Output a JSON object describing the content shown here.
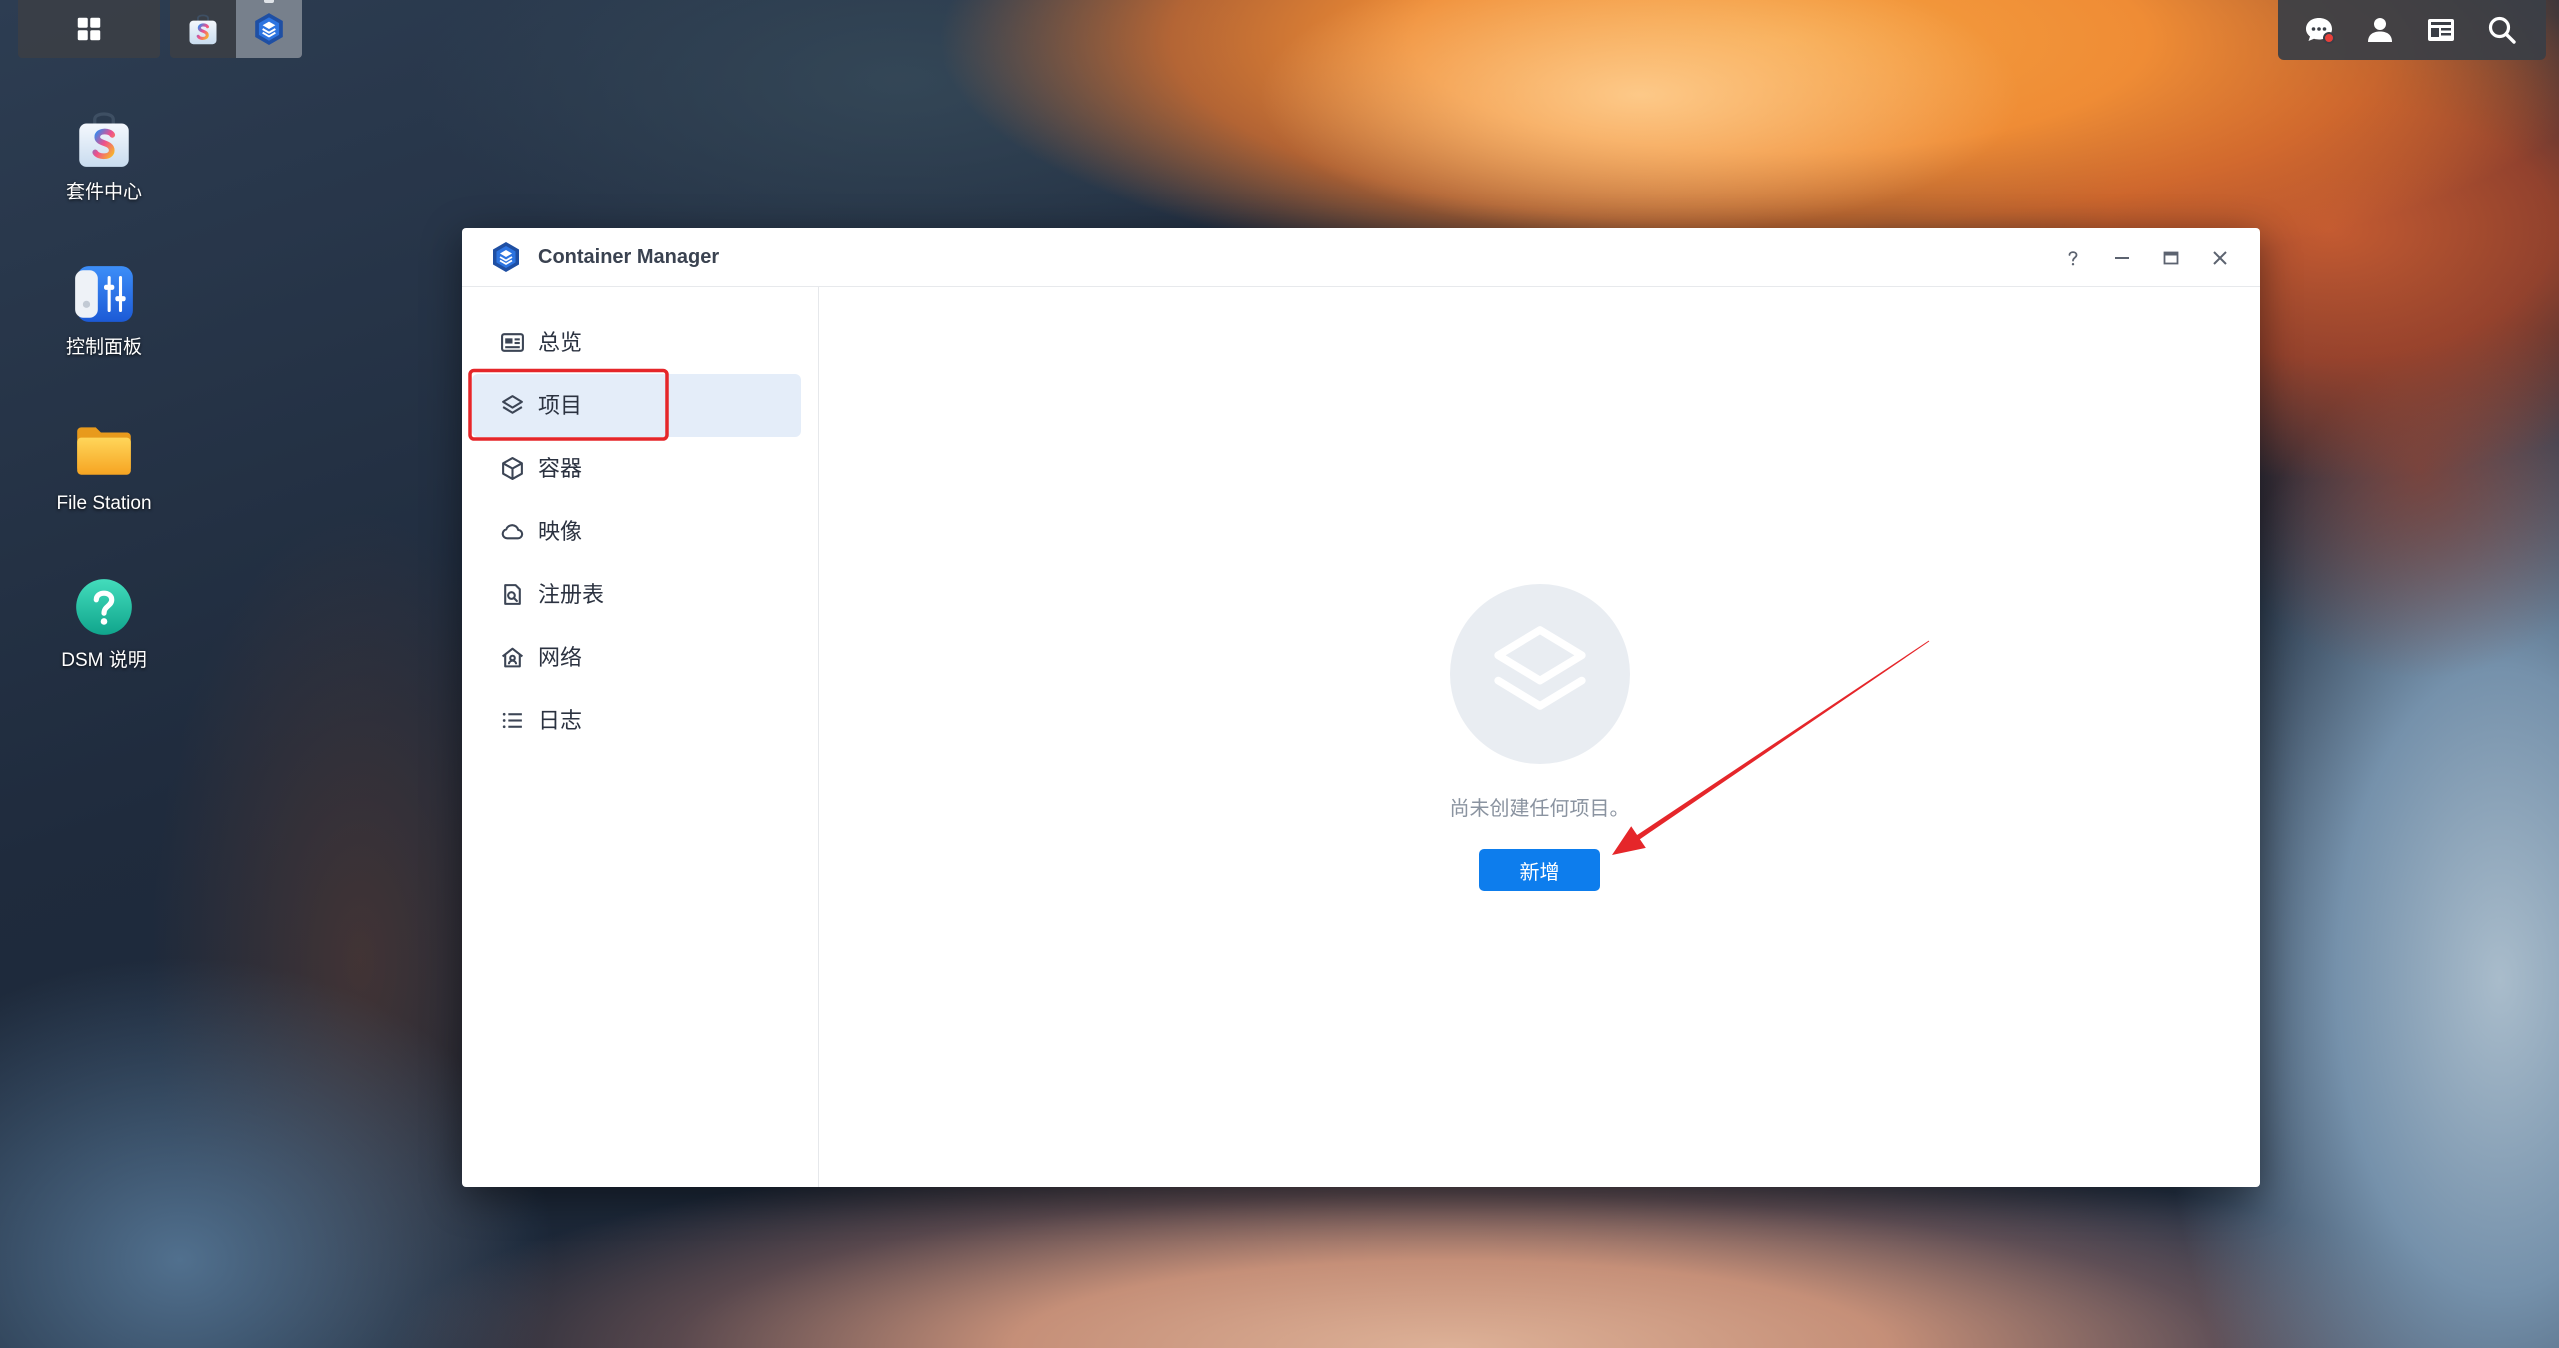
{
  "taskbar": {
    "main_menu_icon": "main-menu-grid-icon",
    "open_apps": [
      {
        "icon": "package-center-icon",
        "active": false
      },
      {
        "icon": "container-manager-icon",
        "active": true
      }
    ]
  },
  "tray": {
    "icons": [
      "chat-icon",
      "user-icon",
      "widgets-icon",
      "search-icon"
    ],
    "chat_has_notification": true
  },
  "desktop": {
    "icons": [
      {
        "label": "套件中心",
        "icon": "package-center-icon",
        "logo_letter": "S"
      },
      {
        "label": "控制面板",
        "icon": "control-panel-icon"
      },
      {
        "label": "File Station",
        "icon": "file-station-icon"
      },
      {
        "label": "DSM 说明",
        "icon": "dsm-help-icon"
      }
    ]
  },
  "window": {
    "title": "Container Manager",
    "icon": "container-manager-icon",
    "controls": [
      "help-icon",
      "minimize-icon",
      "maximize-icon",
      "close-icon"
    ]
  },
  "sidebar": {
    "items": [
      {
        "label": "总览",
        "icon": "overview-icon",
        "selected": false
      },
      {
        "label": "项目",
        "icon": "layers-icon",
        "selected": true
      },
      {
        "label": "容器",
        "icon": "cube-icon",
        "selected": false
      },
      {
        "label": "映像",
        "icon": "cloud-icon",
        "selected": false
      },
      {
        "label": "注册表",
        "icon": "registry-search-icon",
        "selected": false
      },
      {
        "label": "网络",
        "icon": "network-icon",
        "selected": false
      },
      {
        "label": "日志",
        "icon": "list-icon",
        "selected": false
      }
    ]
  },
  "main": {
    "empty_state": {
      "icon": "layers-icon",
      "message": "尚未创建任何项目。",
      "add_button_label": "新增"
    }
  },
  "colors": {
    "accent": "#0d7ded",
    "sidebar_selected_bg": "#e4edf9",
    "annotation_red": "#e5262a",
    "notification_red": "#e8403a"
  }
}
